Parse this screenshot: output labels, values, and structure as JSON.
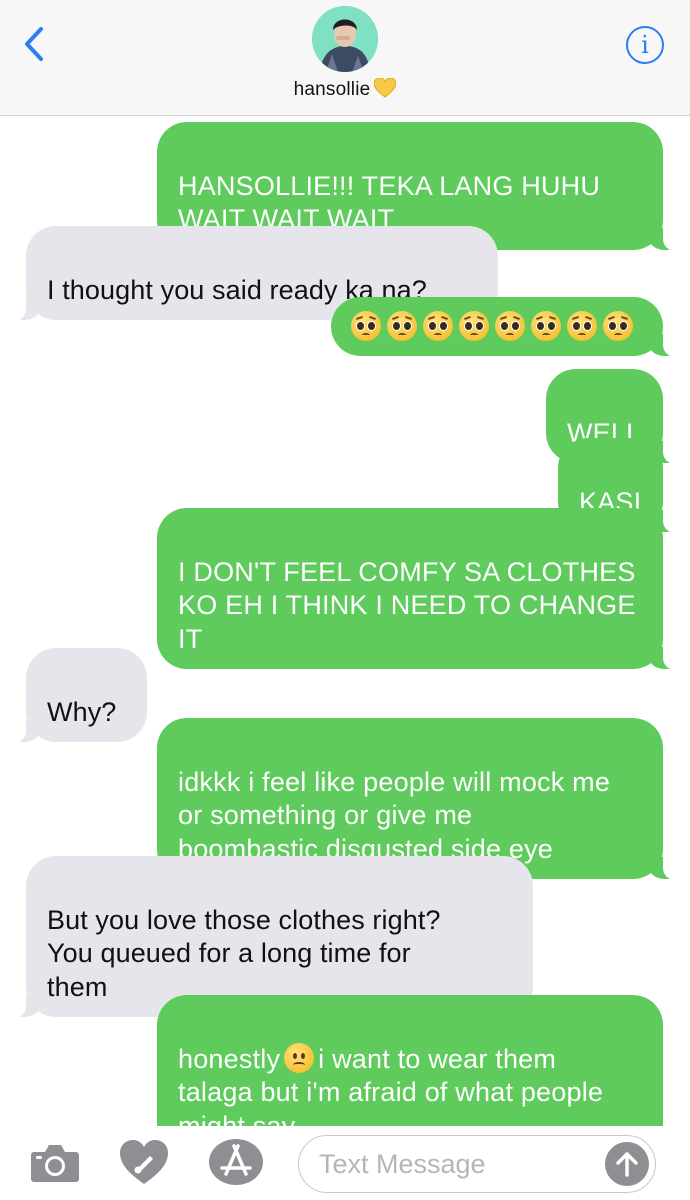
{
  "header": {
    "contact_name": "hansollie",
    "contact_heart": "yellow-heart-icon",
    "back_icon": "chevron-left-icon",
    "info_label": "i",
    "accent": "#2a7ef5"
  },
  "messages": [
    {
      "side": "outgoing",
      "text": "HANSOLLIE!!! TEKA LANG HUHU\nWAIT WAIT WAIT"
    },
    {
      "side": "incoming",
      "text": "I thought you said ready ka na?"
    },
    {
      "side": "outgoing",
      "emoji": "pleading-face-icon",
      "emoji_count": 8
    },
    {
      "side": "outgoing",
      "text": "WELL"
    },
    {
      "side": "outgoing",
      "text": "KASI"
    },
    {
      "side": "outgoing",
      "text": "I DON'T FEEL COMFY SA CLOTHES\nKO EH I THINK I NEED TO CHANGE\nIT"
    },
    {
      "side": "incoming",
      "text": "Why?"
    },
    {
      "side": "outgoing",
      "text": "idkkk i feel like people will mock me\nor something or give me\nboombastic disgusted side eye"
    },
    {
      "side": "incoming",
      "text": "But you love those clothes right?\nYou queued for a long time for\nthem"
    },
    {
      "side": "outgoing",
      "text_before_emoji": "honestly",
      "emoji": "frowning-face-icon",
      "text_after_emoji": "i want to wear them\ntalaga but i'm afraid of what people\nmight say"
    }
  ],
  "composer": {
    "placeholder": "Text Message",
    "camera_icon": "camera-icon",
    "digital_touch_icon": "digital-touch-heart-icon",
    "app_store_icon": "app-store-icon",
    "send_icon": "send-arrow-up-icon"
  },
  "colors": {
    "outgoing_bubble": "#5ecb5c",
    "incoming_bubble": "#e6e5eb",
    "send_button": "#8e8e93"
  }
}
